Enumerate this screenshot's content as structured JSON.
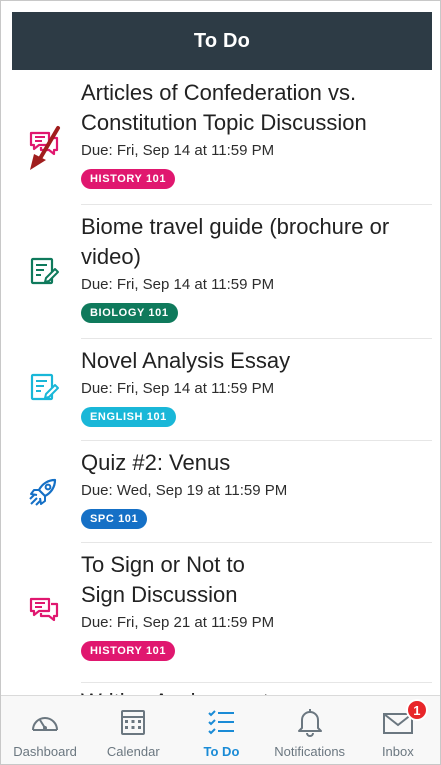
{
  "header": {
    "title": "To Do"
  },
  "items": [
    {
      "title": "Articles of Confederation vs. Constitution Topic Discussion",
      "due": "Due: Fri, Sep 14 at 11:59 PM",
      "course": "HISTORY 101",
      "icon": "discussion-icon",
      "color": "#e0176f"
    },
    {
      "title": "Biome travel guide (brochure or video)",
      "due": "Due: Fri, Sep 14 at 11:59 PM",
      "course": "BIOLOGY 101",
      "icon": "assignment-icon",
      "color": "#0f7a5c"
    },
    {
      "title": "Novel Analysis Essay",
      "due": "Due: Fri, Sep 14 at 11:59 PM",
      "course": "ENGLISH 101",
      "icon": "assignment-icon",
      "color": "#19b7d8"
    },
    {
      "title": "Quiz #2: Venus",
      "due": "Due: Wed, Sep 19 at 11:59 PM",
      "course": "SPC 101",
      "icon": "quiz-rocket-icon",
      "color": "#1570c6"
    },
    {
      "title": "To Sign or Not to Sign Discussion",
      "due": "Due: Fri, Sep 21 at 11:59 PM",
      "course": "HISTORY 101",
      "icon": "discussion-icon",
      "color": "#e0176f"
    }
  ],
  "partial_item": {
    "title": "Writing Assignment"
  },
  "tabbar": {
    "tabs": [
      {
        "label": "Dashboard",
        "icon": "dashboard-gauge-icon"
      },
      {
        "label": "Calendar",
        "icon": "calendar-icon"
      },
      {
        "label": "To Do",
        "icon": "todo-list-icon",
        "active": true
      },
      {
        "label": "Notifications",
        "icon": "bell-icon"
      },
      {
        "label": "Inbox",
        "icon": "inbox-envelope-icon",
        "badge": "1"
      }
    ]
  },
  "colors": {
    "header_bg": "#2d3b45",
    "active_tab": "#1a8bd6",
    "arrow": "#a01d1d"
  }
}
